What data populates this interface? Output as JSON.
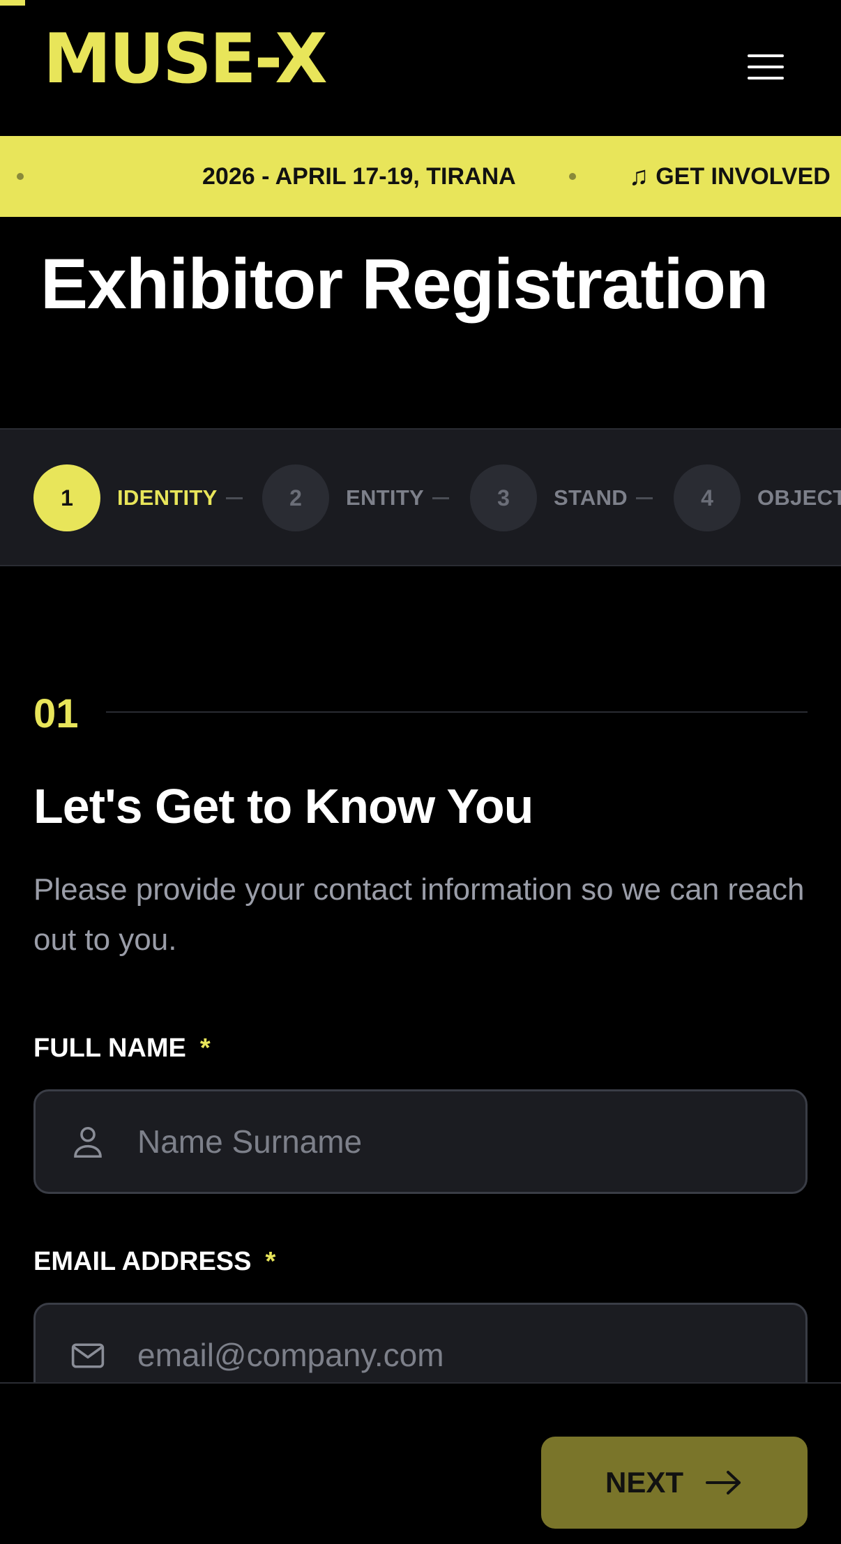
{
  "header": {
    "logo_text": "MUSE-X",
    "menu_icon": "hamburger-menu-icon"
  },
  "marquee": {
    "items": [
      {
        "text": "2026 - APRIL 17-19, TIRANA"
      },
      {
        "icon": "music-note-icon",
        "text": "GET INVOLVED"
      }
    ]
  },
  "page": {
    "title": "Exhibitor Registration"
  },
  "stepper": {
    "steps": [
      {
        "number": "1",
        "label": "IDENTITY",
        "active": true
      },
      {
        "number": "2",
        "label": "ENTITY",
        "active": false
      },
      {
        "number": "3",
        "label": "STAND",
        "active": false
      },
      {
        "number": "4",
        "label": "OBJECTIVES",
        "active": false
      }
    ]
  },
  "section": {
    "number": "01",
    "title": "Let's Get to Know You",
    "description": "Please provide your contact information so we can reach out to you."
  },
  "form": {
    "full_name": {
      "label": "FULL NAME",
      "required_mark": "*",
      "placeholder": "Name Surname",
      "value": "",
      "icon": "user-icon"
    },
    "email": {
      "label": "EMAIL ADDRESS",
      "required_mark": "*",
      "placeholder": "email@company.com",
      "value": "",
      "icon": "mail-icon"
    }
  },
  "footer": {
    "next_label": "NEXT",
    "next_icon": "arrow-right-icon"
  },
  "colors": {
    "accent": "#e8e55a",
    "background": "#000000",
    "panel": "#1a1b20",
    "next_button": "#7a752a",
    "muted_text": "#9a9da8"
  }
}
